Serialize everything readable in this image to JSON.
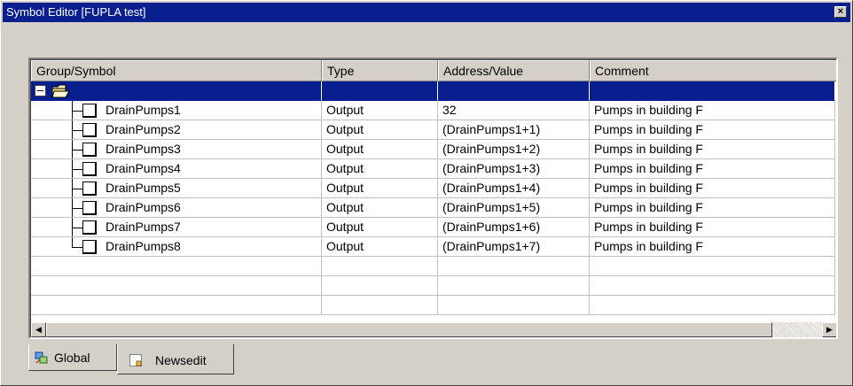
{
  "window": {
    "title": "Symbol Editor [FUPLA test]",
    "close_glyph": "×",
    "title_color": "#0a1f8f"
  },
  "grid": {
    "columns": [
      "Group/Symbol",
      "Type",
      "Address/Value",
      "Comment"
    ],
    "root_row": {
      "icon": "folder-open-icon",
      "expander": "−",
      "selected": true
    },
    "rows": [
      {
        "symbol": "DrainPumps1",
        "type": "Output",
        "address": "32",
        "comment": "Pumps in building F"
      },
      {
        "symbol": "DrainPumps2",
        "type": "Output",
        "address": "(DrainPumps1+1)",
        "comment": "Pumps in building F"
      },
      {
        "symbol": "DrainPumps3",
        "type": "Output",
        "address": "(DrainPumps1+2)",
        "comment": "Pumps in building F"
      },
      {
        "symbol": "DrainPumps4",
        "type": "Output",
        "address": "(DrainPumps1+3)",
        "comment": "Pumps in building F"
      },
      {
        "symbol": "DrainPumps5",
        "type": "Output",
        "address": "(DrainPumps1+4)",
        "comment": "Pumps in building F"
      },
      {
        "symbol": "DrainPumps6",
        "type": "Output",
        "address": "(DrainPumps1+5)",
        "comment": "Pumps in building F"
      },
      {
        "symbol": "DrainPumps7",
        "type": "Output",
        "address": "(DrainPumps1+6)",
        "comment": "Pumps in building F"
      },
      {
        "symbol": "DrainPumps8",
        "type": "Output",
        "address": "(DrainPumps1+7)",
        "comment": "Pumps in building F"
      }
    ]
  },
  "scrollbar": {
    "left_arrow": "◀",
    "right_arrow": "▶"
  },
  "tabs": [
    {
      "label": "Global",
      "icon": "global-symbols-icon",
      "active": false
    },
    {
      "label": "Newsedit",
      "icon": "document-icon",
      "active": true
    }
  ]
}
